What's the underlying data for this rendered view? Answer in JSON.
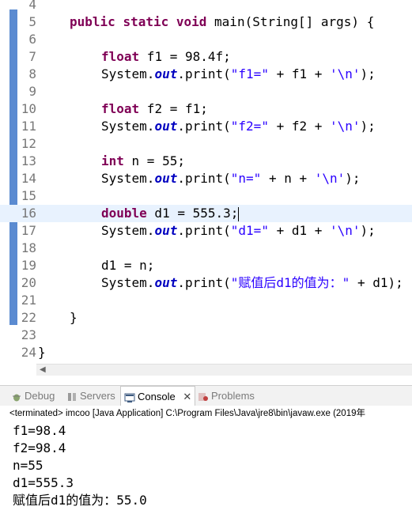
{
  "editor": {
    "lines": [
      {
        "n": "4"
      },
      {
        "n": "5"
      },
      {
        "n": "6"
      },
      {
        "n": "7"
      },
      {
        "n": "8"
      },
      {
        "n": "9"
      },
      {
        "n": "10"
      },
      {
        "n": "11"
      },
      {
        "n": "12"
      },
      {
        "n": "13"
      },
      {
        "n": "14"
      },
      {
        "n": "15"
      },
      {
        "n": "16"
      },
      {
        "n": "17"
      },
      {
        "n": "18"
      },
      {
        "n": "19"
      },
      {
        "n": "20"
      },
      {
        "n": "21"
      },
      {
        "n": "22"
      },
      {
        "n": "23"
      },
      {
        "n": "24"
      }
    ],
    "tokens": {
      "public": "public",
      "static": "static",
      "void": "void",
      "main_sig": " main(String[] args) {",
      "float": "float",
      "f1_decl": " f1 = 98.4f;",
      "system": "System.",
      "out": "out",
      "print_open": ".print(",
      "f1_str": "\"f1=\"",
      "f1_rest": " + f1 + ",
      "nl": "'\\n'",
      "close": ");",
      "f2_decl": " f2 = f1;",
      "f2_str": "\"f2=\"",
      "f2_rest": " + f2 + ",
      "int": "int",
      "n_decl": " n = 55;",
      "n_str": "\"n=\"",
      "n_rest": " + n + ",
      "double": "double",
      "d1_decl": " d1 = 555.3;",
      "d1_str": "\"d1=\"",
      "d1_rest": " + d1 + ",
      "d1_assign": "d1 = n;",
      "cn_str": "\"赋值后d1的值为：\"",
      "cn_rest": " + d1);",
      "brace_inner": "}",
      "brace_outer": "}"
    }
  },
  "panel": {
    "tabs": [
      {
        "label": "Debug"
      },
      {
        "label": "Servers"
      },
      {
        "label": "Console"
      },
      {
        "label": "Problems"
      }
    ],
    "status": "<terminated> imcoo [Java Application] C:\\Program Files\\Java\\jre8\\bin\\javaw.exe (2019年",
    "output": [
      "f1=98.4",
      "f2=98.4",
      "n=55",
      "d1=555.3",
      "赋值后d1的值为：55.0"
    ]
  },
  "colors": {
    "keyword": "#7f0055",
    "string": "#2a00ff",
    "field": "#0000c0",
    "current_line": "#e8f2fe",
    "change_bar": "#5b8bd1"
  }
}
